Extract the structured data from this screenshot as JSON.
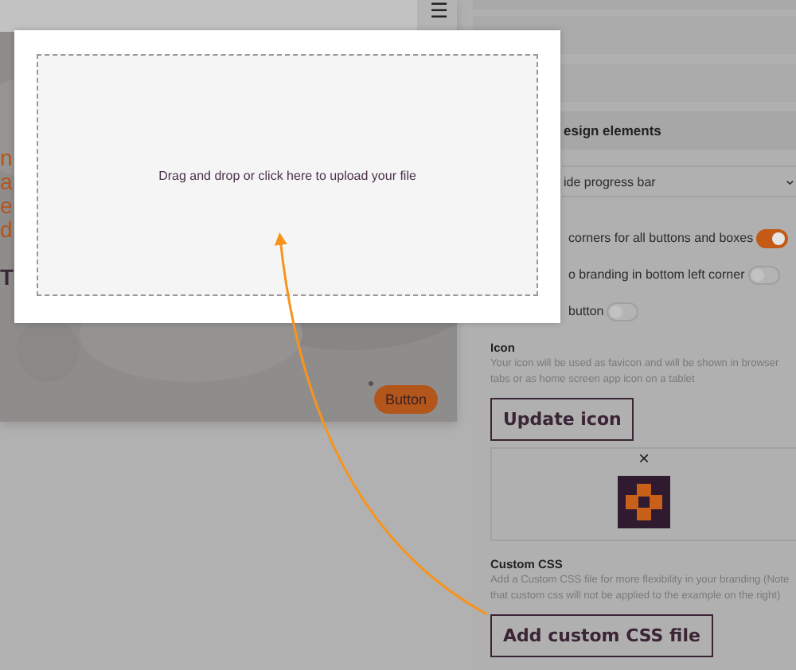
{
  "preview": {
    "menu_icon": "☰",
    "fragments": [
      {
        "text": "n",
        "kind": "accent"
      },
      {
        "text": "a",
        "kind": "accent"
      },
      {
        "text": "e",
        "kind": "accent"
      },
      {
        "text": "d",
        "kind": "accent"
      },
      {
        "text": "T",
        "kind": "heading"
      }
    ],
    "button": "Button"
  },
  "upload_dialog": {
    "prompt": "Drag and drop or click here to upload your file"
  },
  "settings": {
    "section_title": "esign elements",
    "dropdown": {
      "value": "ide progress bar",
      "chevron": "⌄"
    },
    "toggles": [
      {
        "label": "corners for all buttons and boxes",
        "on": true
      },
      {
        "label": "o branding in bottom left corner",
        "on": false
      },
      {
        "label": "button",
        "on": false
      }
    ],
    "icon": {
      "title": "Icon",
      "description": "Your icon will be used as favicon and will be shown in browser tabs or as home screen app icon on a tablet",
      "button": "Update icon",
      "remove": "×"
    },
    "custom_css": {
      "title": "Custom CSS",
      "description": "Add a Custom CSS file for more flexibility in your branding (Note that custom css will not be applied to the example on the right)",
      "button": "Add custom CSS file"
    }
  }
}
